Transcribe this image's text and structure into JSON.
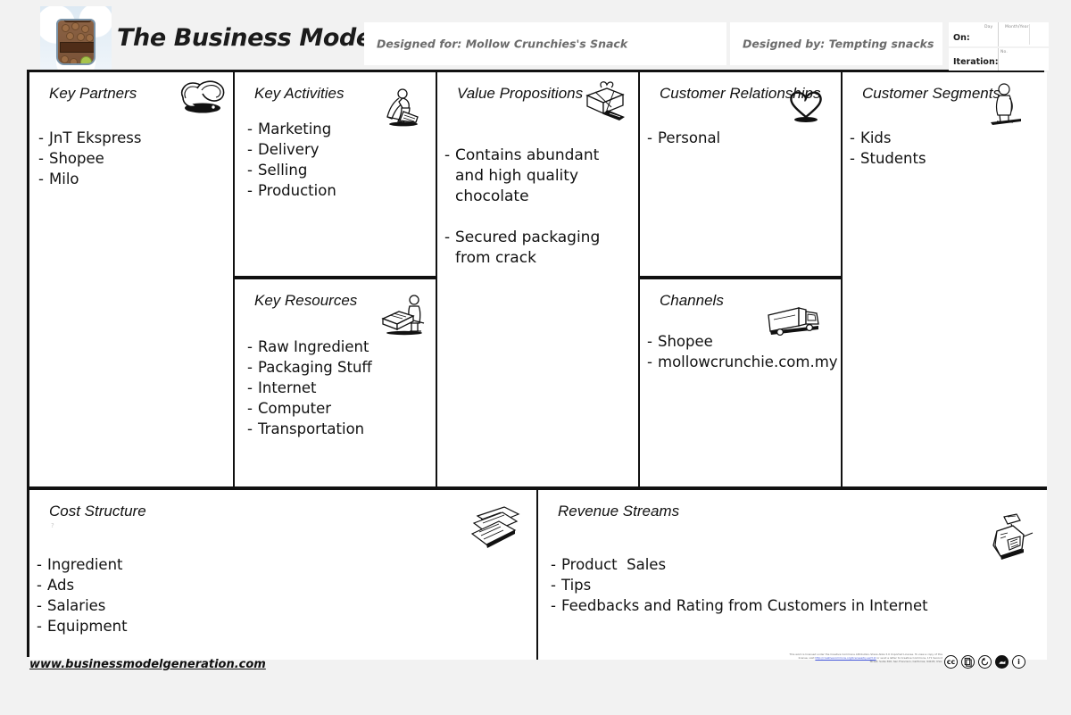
{
  "header": {
    "title": "The Business Model Canvas",
    "logo_icon": "nut-jar-logo",
    "designed_for": "Designed for: Mollow Crunchies's Snack",
    "designed_by": "Designed by: Tempting snacks",
    "on_label": "On:",
    "on_day_label": "Day",
    "on_monthyear_label": "Month/Year",
    "iteration_label": "Iteration:",
    "iteration_no_label": "No."
  },
  "blocks": {
    "key_partners": {
      "title": "Key Partners",
      "icon": "chain-links-icon",
      "items": [
        "JnT Ekspress",
        "Shopee",
        "Milo"
      ]
    },
    "key_activities": {
      "title": "Key Activities",
      "icon": "worker-pushing-icon",
      "items": [
        "Marketing",
        "Delivery",
        "Selling",
        "Production"
      ]
    },
    "key_resources": {
      "title": "Key Resources",
      "icon": "person-at-machine-icon",
      "items": [
        "Raw Ingredient",
        "Packaging Stuff",
        "Internet",
        "Computer",
        "Transportation"
      ]
    },
    "value_propositions": {
      "title": "Value Propositions",
      "icon": "gift-box-icon",
      "items": [
        "Contains abundant and high quality chocolate",
        "Secured packaging from crack"
      ]
    },
    "customer_relationships": {
      "title": "Customer Relationships",
      "icon": "heart-icon",
      "items": [
        "Personal"
      ]
    },
    "channels": {
      "title": "Channels",
      "icon": "delivery-truck-icon",
      "items": [
        "Shopee",
        "mollowcrunchie.com.my"
      ]
    },
    "customer_segments": {
      "title": "Customer Segments",
      "icon": "standing-person-icon",
      "items": [
        "Kids",
        "Students"
      ]
    },
    "cost_structure": {
      "title": "Cost Structure",
      "icon": "invoice-papers-icon",
      "mark": "?",
      "items": [
        "Ingredient",
        "Ads",
        "Salaries",
        "Equipment"
      ]
    },
    "revenue_streams": {
      "title": "Revenue Streams",
      "icon": "cash-register-icon",
      "items": [
        "Product  Sales",
        "Tips",
        "Feedbacks and Rating from Customers in Internet"
      ]
    }
  },
  "footer": {
    "url": "www.businessmodelgeneration.com",
    "license_line1": "This work is licensed under the Creative Commons Attribution-Share Alike 3.0 Unported License.",
    "license_line2": "To view a copy of this license, visit",
    "license_link": "http://creativecommons.org/licenses/by-sa/3.0/",
    "license_line3": "or send a letter to Creative Commons, 171 Second Street, Suite 300, San Francisco, California,",
    "license_line4": "94105, USA.",
    "badges": [
      "cc-icon",
      "by-person-icon",
      "share-alike-icon",
      "nc-filled-icon",
      "info-icon"
    ]
  },
  "colors": {
    "page_background": "#f2f2f2",
    "canvas_background": "#ffffff",
    "border": "#111111",
    "header_text": "#6b6b6b",
    "link": "#3b4fd8"
  }
}
